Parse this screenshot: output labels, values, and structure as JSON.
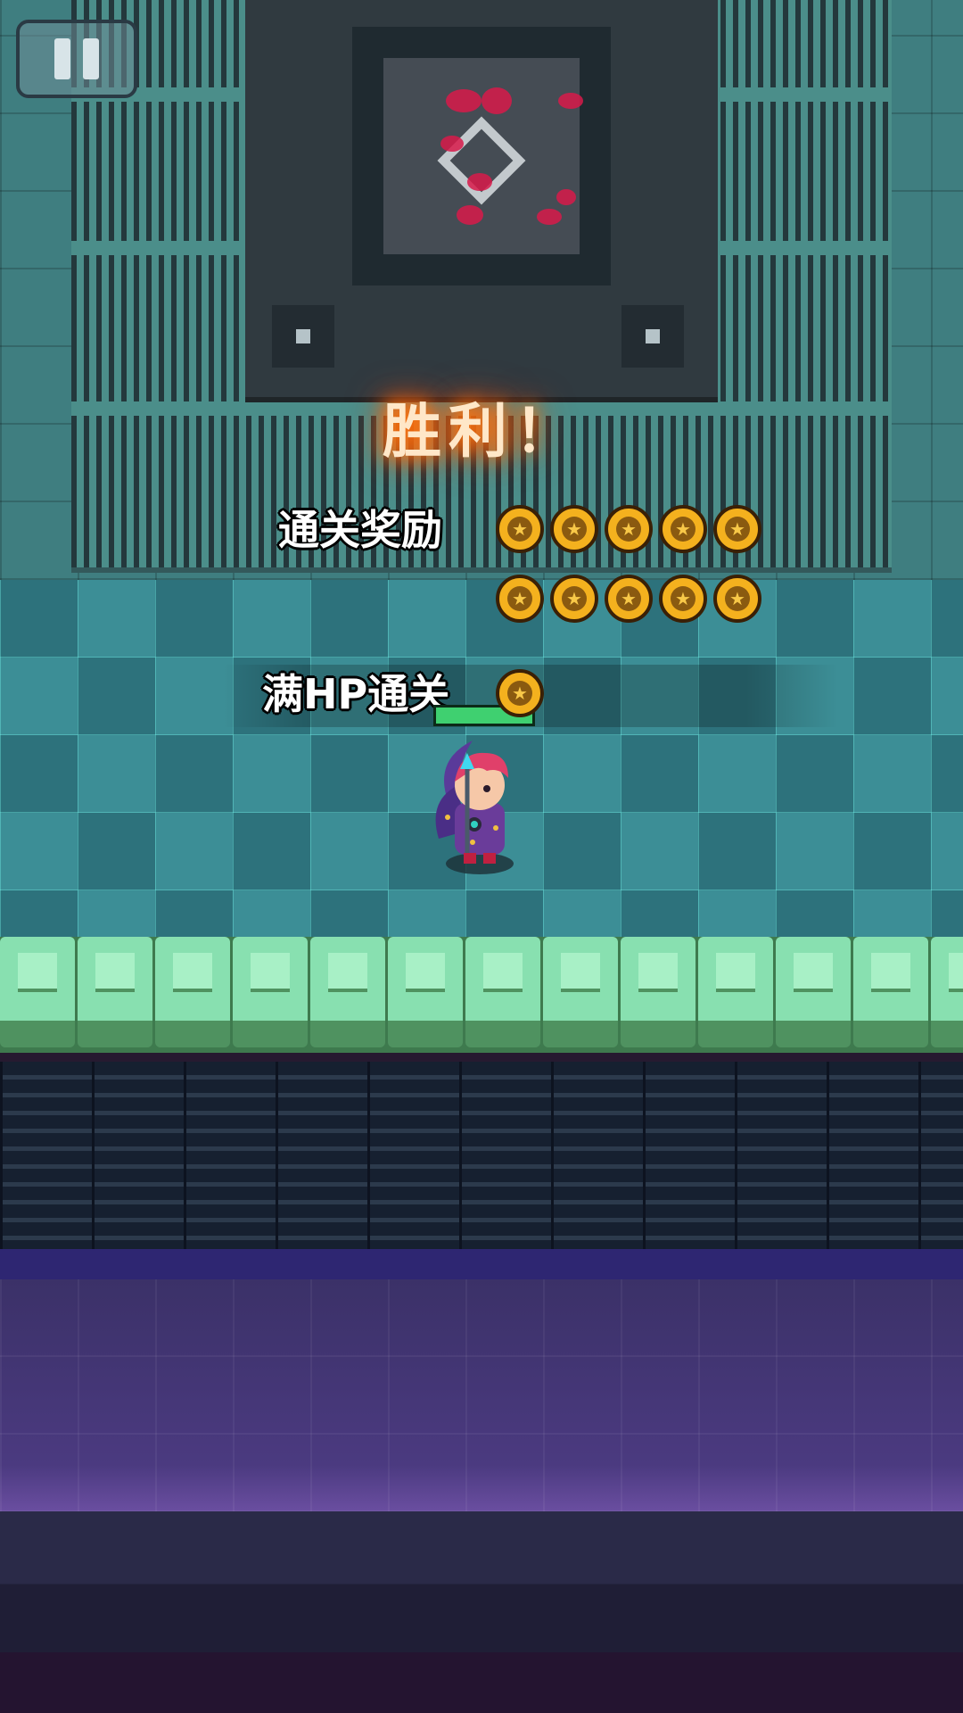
{
  "hud": {
    "pause_icon": "pause-icon"
  },
  "result": {
    "title": "胜利！",
    "clear_reward": {
      "label": "通关奖励",
      "coin_rows": [
        5,
        5
      ],
      "coin_icon": "star-coin-icon"
    },
    "full_hp_reward": {
      "label": "满HP通关",
      "coins": 1,
      "coin_icon": "star-coin-icon"
    }
  },
  "player": {
    "hp_fraction": 1.0
  },
  "colors": {
    "coin": "#f4b11e",
    "victory_glow": "#ff7a10",
    "floor": "#3c8e96"
  }
}
